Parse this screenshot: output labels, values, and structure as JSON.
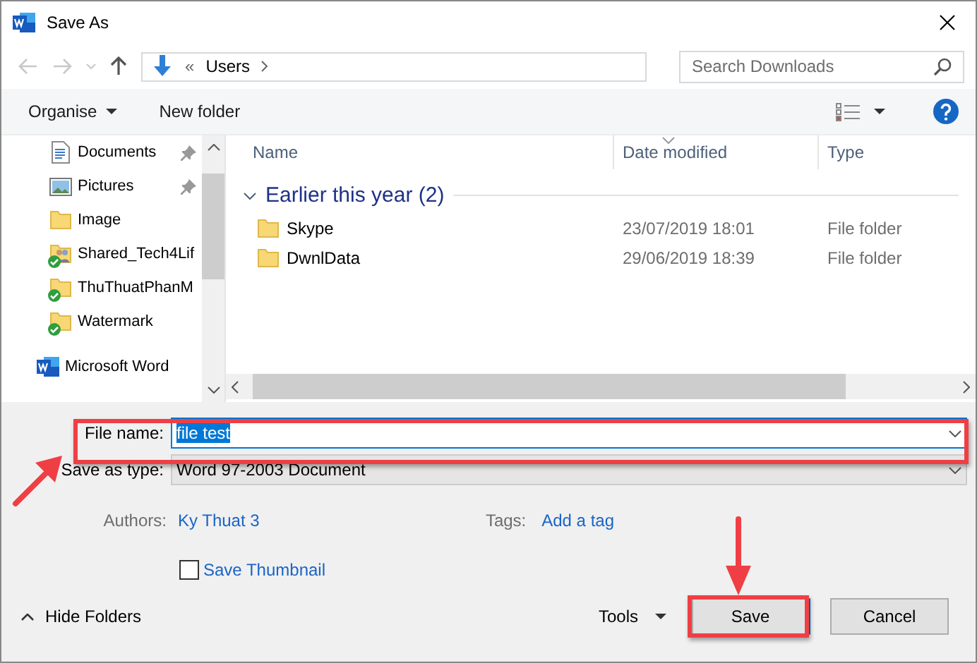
{
  "window": {
    "title": "Save As"
  },
  "navigation": {
    "breadcrumb_prefix": "«",
    "breadcrumb": [
      {
        "label": "Users"
      }
    ],
    "search": {
      "placeholder": "Search Downloads"
    }
  },
  "toolbar": {
    "organise": "Organise",
    "new_folder": "New folder"
  },
  "sidebar": {
    "items": [
      {
        "label": "Documents",
        "kind": "documents",
        "pinned": true,
        "synced": false
      },
      {
        "label": "Pictures",
        "kind": "pictures",
        "pinned": true,
        "synced": false
      },
      {
        "label": "Image",
        "kind": "folder",
        "pinned": false,
        "synced": false
      },
      {
        "label": "Shared_Tech4Lif",
        "kind": "shared-folder",
        "pinned": false,
        "synced": true
      },
      {
        "label": "ThuThuatPhanM",
        "kind": "folder",
        "pinned": false,
        "synced": true
      },
      {
        "label": "Watermark",
        "kind": "folder",
        "pinned": false,
        "synced": true
      },
      {
        "label": "Microsoft Word",
        "kind": "word",
        "pinned": false,
        "synced": false
      }
    ]
  },
  "columns": [
    {
      "label": "Name",
      "sorted": false
    },
    {
      "label": "Date modified",
      "sorted": true
    },
    {
      "label": "Type",
      "sorted": false
    }
  ],
  "groups": [
    {
      "label": "Earlier this year (2)",
      "expanded": true,
      "rows": [
        {
          "name": "Skype",
          "date": "23/07/2019 18:01",
          "type": "File folder"
        },
        {
          "name": "DwnlData",
          "date": "29/06/2019 18:39",
          "type": "File folder"
        }
      ]
    }
  ],
  "form": {
    "file_name": {
      "label": "File name:",
      "value": "file test"
    },
    "save_as_type": {
      "label": "Save as type:",
      "value": "Word 97-2003 Document"
    },
    "authors": {
      "label": "Authors:",
      "value": "Ky Thuat 3"
    },
    "tags": {
      "label": "Tags:",
      "value": "Add a tag"
    },
    "save_thumbnail": {
      "label": "Save Thumbnail",
      "checked": false
    }
  },
  "footer": {
    "hide_folders": "Hide Folders",
    "tools": "Tools",
    "save": "Save",
    "cancel": "Cancel"
  }
}
